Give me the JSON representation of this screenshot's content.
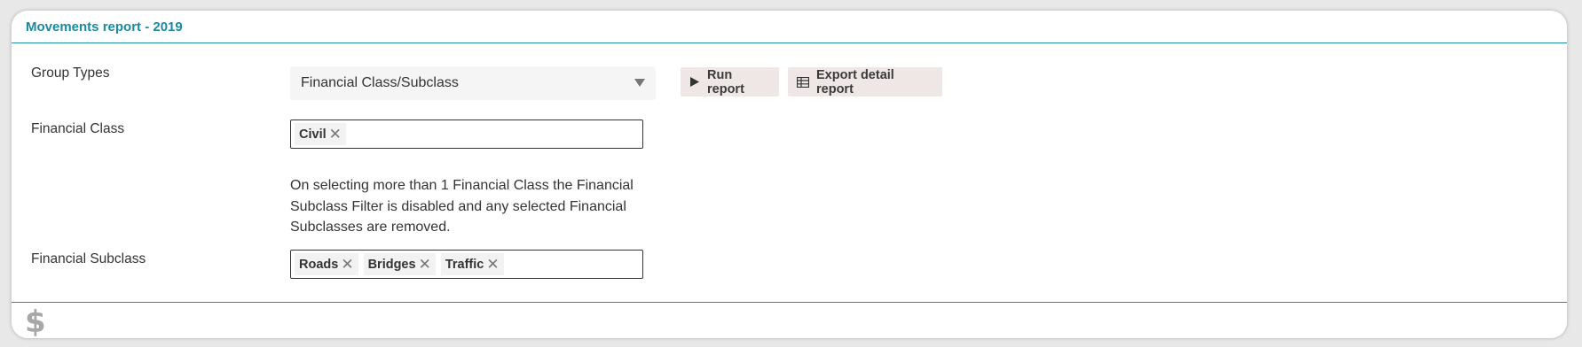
{
  "panel": {
    "title": "Movements report - 2019"
  },
  "form": {
    "group_types": {
      "label": "Group Types",
      "selected": "Financial Class/Subclass"
    },
    "financial_class": {
      "label": "Financial Class",
      "tags": [
        "Civil"
      ],
      "help_text": "On selecting more than 1 Financial Class the Financial Subclass Filter is disabled and any selected Financial Subclasses are removed."
    },
    "financial_subclass": {
      "label": "Financial Subclass",
      "tags": [
        "Roads",
        "Bridges",
        "Traffic"
      ]
    }
  },
  "actions": {
    "run_report": "Run report",
    "export_detail_report": "Export detail report"
  },
  "footer": {
    "icon": "dollar-icon",
    "icon_glyph": "$"
  },
  "colors": {
    "accent": "#1a8aa0",
    "button_bg": "#efe6e6"
  }
}
